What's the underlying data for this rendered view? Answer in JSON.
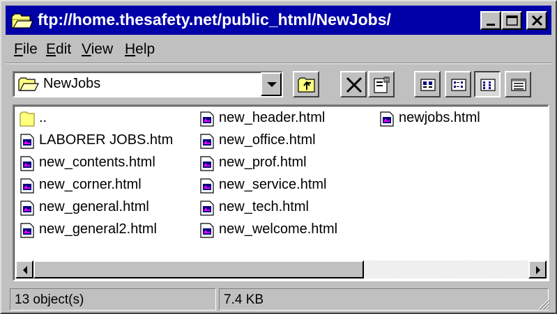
{
  "window": {
    "title": "ftp://home.thesafety.net/public_html/NewJobs/",
    "title_icon": "ftp-folder-icon",
    "controls": [
      "minimize-icon",
      "maximize-icon",
      "close-icon"
    ]
  },
  "menu": {
    "items": [
      {
        "label": "File",
        "accel": "F",
        "rest": "ile"
      },
      {
        "label": "Edit",
        "accel": "E",
        "rest": "dit"
      },
      {
        "label": "View",
        "accel": "V",
        "rest": "iew"
      },
      {
        "label": "Help",
        "accel": "H",
        "rest": "elp"
      }
    ]
  },
  "toolbar": {
    "address_value": "NewJobs",
    "address_icon": "folder-open-icon",
    "buttons": [
      "up-folder-icon",
      "delete-icon",
      "properties-icon",
      "large-icons-view-icon",
      "small-icons-view-icon",
      "list-view-icon",
      "details-view-icon"
    ],
    "active_view": "list-view-icon"
  },
  "files": [
    {
      "name": "..",
      "icon": "folder-icon"
    },
    {
      "name": "LABORER JOBS.htm",
      "icon": "html-file-icon"
    },
    {
      "name": "new_contents.html",
      "icon": "html-file-icon"
    },
    {
      "name": "new_corner.html",
      "icon": "html-file-icon"
    },
    {
      "name": "new_general.html",
      "icon": "html-file-icon"
    },
    {
      "name": "new_general2.html",
      "icon": "html-file-icon"
    },
    {
      "name": "new_header.html",
      "icon": "html-file-icon"
    },
    {
      "name": "new_office.html",
      "icon": "html-file-icon"
    },
    {
      "name": "new_prof.html",
      "icon": "html-file-icon"
    },
    {
      "name": "new_service.html",
      "icon": "html-file-icon"
    },
    {
      "name": "new_tech.html",
      "icon": "html-file-icon"
    },
    {
      "name": "new_welcome.html",
      "icon": "html-file-icon"
    },
    {
      "name": "newjobs.html",
      "icon": "html-file-icon"
    }
  ],
  "status": {
    "objects": "13 object(s)",
    "size": "7.4 KB"
  },
  "colors": {
    "title_bar": "#0000a8",
    "face": "#c0c0c0",
    "folder": "#ffff80"
  }
}
